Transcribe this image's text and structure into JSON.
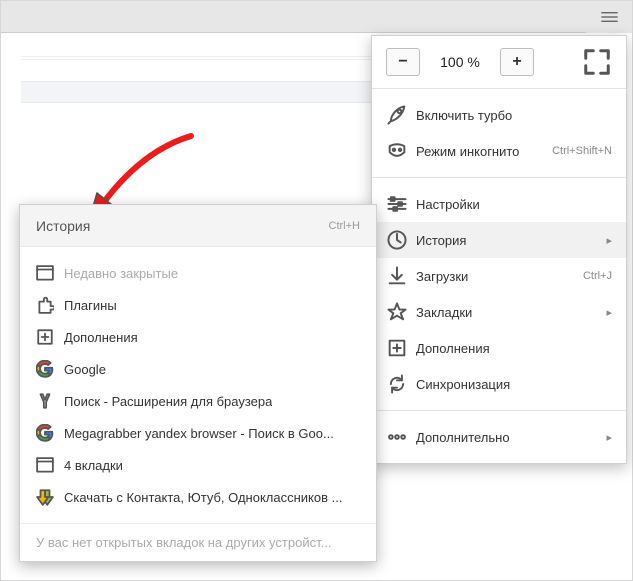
{
  "zoom": {
    "minus": "−",
    "value": "100 %",
    "plus": "+"
  },
  "main_menu": {
    "turbo": "Включить турбо",
    "incognito": "Режим инкогнито",
    "incognito_sc": "Ctrl+Shift+N",
    "settings": "Настройки",
    "history": "История",
    "downloads": "Загрузки",
    "downloads_sc": "Ctrl+J",
    "bookmarks": "Закладки",
    "addons": "Дополнения",
    "sync": "Синхронизация",
    "more": "Дополнительно"
  },
  "history_menu": {
    "title": "История",
    "title_sc": "Ctrl+H",
    "recent_closed": "Недавно закрытые",
    "plugins": "Плагины",
    "addons": "Дополнения",
    "google": "Google",
    "search_ext": "Поиск - Расширения для браузера",
    "megagrabber": "Megagrabber yandex browser - Поиск в Goo...",
    "tabs4": "4 вкладки",
    "download": "Скачать с Контакта, Ютуб, Одноклассников ...",
    "footer": "У вас нет открытых вкладок на других устройст..."
  }
}
